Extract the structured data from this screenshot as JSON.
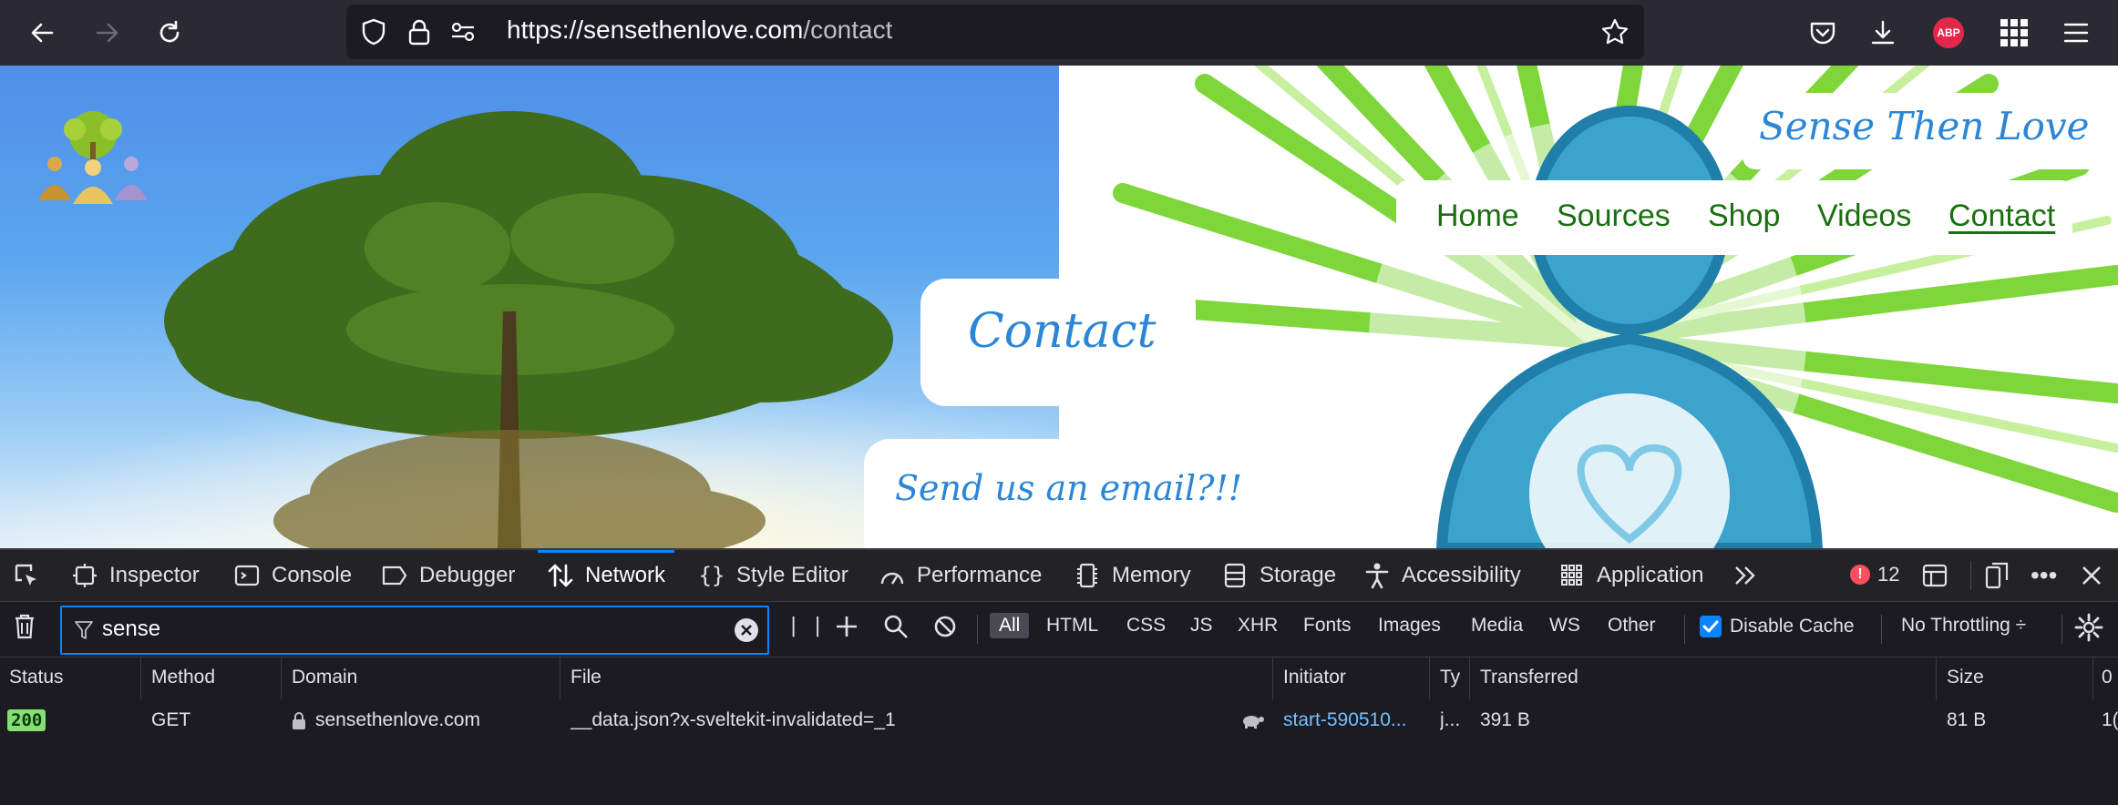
{
  "browser": {
    "url_host": "https://sensethenlove.com",
    "url_path": "/contact",
    "abp_label": "ABP",
    "icons": [
      "back-arrow-icon",
      "forward-arrow-icon",
      "reload-icon",
      "shield-icon",
      "lock-icon",
      "permissions-icon",
      "bookmark-star-icon",
      "pocket-icon",
      "download-icon",
      "adblock-icon",
      "apps-grid-icon",
      "hamburger-menu-icon"
    ]
  },
  "site": {
    "brand": "Sense Then Love",
    "nav": [
      {
        "label": "Home"
      },
      {
        "label": "Sources"
      },
      {
        "label": "Shop"
      },
      {
        "label": "Videos"
      },
      {
        "label": "Contact",
        "active": true
      }
    ],
    "page_title": "Contact",
    "email_prompt": "Send us an email?!!",
    "colors": {
      "brand_blue": "#2b86d6",
      "nav_green": "#1b6e12",
      "ray_green": "#7ed63a",
      "figure_blue": "#3ba3cc"
    }
  },
  "devtools": {
    "tabs": [
      {
        "label": "Inspector",
        "icon": "inspector-icon"
      },
      {
        "label": "Console",
        "icon": "console-icon"
      },
      {
        "label": "Debugger",
        "icon": "debugger-icon"
      },
      {
        "label": "Network",
        "icon": "network-icon",
        "active": true
      },
      {
        "label": "Style Editor",
        "icon": "braces-icon"
      },
      {
        "label": "Performance",
        "icon": "gauge-icon"
      },
      {
        "label": "Memory",
        "icon": "memory-chip-icon"
      },
      {
        "label": "Storage",
        "icon": "storage-icon"
      },
      {
        "label": "Accessibility",
        "icon": "accessibility-icon"
      },
      {
        "label": "Application",
        "icon": "application-grid-icon"
      }
    ],
    "error_count": "12",
    "filter": {
      "value": "sense"
    },
    "types": [
      "All",
      "HTML",
      "CSS",
      "JS",
      "XHR",
      "Fonts",
      "Images",
      "Media",
      "WS",
      "Other"
    ],
    "disable_cache": {
      "label": "Disable Cache",
      "checked": true
    },
    "throttling": "No Throttling ÷",
    "columns": [
      "Status",
      "Method",
      "Domain",
      "File",
      "Initiator",
      "Ty",
      "Transferred",
      "Size",
      "0"
    ],
    "rows": [
      {
        "status": "200",
        "method": "GET",
        "domain": "sensethenlove.com",
        "file": "__data.json?x-sveltekit-invalidated=_1",
        "initiator": "start-590510...",
        "type": "j...",
        "transferred": "391 B",
        "size": "81 B",
        "extra": "1("
      }
    ]
  }
}
